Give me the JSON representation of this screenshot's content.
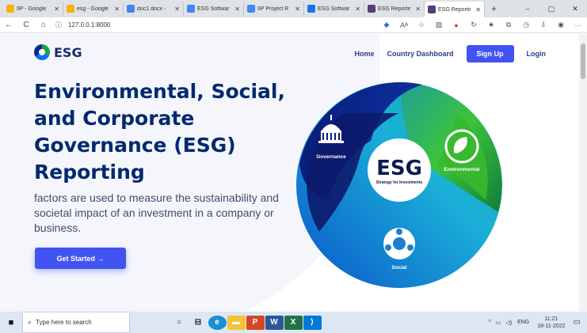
{
  "browser": {
    "tabs": [
      {
        "label": "IIP - Google",
        "icon": "google-drive-icon",
        "color": "#f4b400",
        "active": false
      },
      {
        "label": "esg - Google",
        "icon": "google-drive-icon",
        "color": "#f4b400",
        "active": false
      },
      {
        "label": "doc1.docx -",
        "icon": "google-docs-icon",
        "color": "#4285f4",
        "active": false
      },
      {
        "label": "ESG Softwar",
        "icon": "google-docs-icon",
        "color": "#4285f4",
        "active": false
      },
      {
        "label": "IIP Project R",
        "icon": "google-docs-icon",
        "color": "#4285f4",
        "active": false
      },
      {
        "label": "ESG Softwar",
        "icon": "globe-icon",
        "color": "#1a73e8",
        "active": false
      },
      {
        "label": "ESG Reportir",
        "icon": "bootstrap-icon",
        "color": "#563d7c",
        "active": false
      },
      {
        "label": "ESG Reportir",
        "icon": "bootstrap-icon",
        "color": "#563d7c",
        "active": true
      }
    ],
    "url": "127.0.0.1:8000"
  },
  "site": {
    "logo_text": "ESG",
    "nav": {
      "home": "Home",
      "country_dashboard": "Country Dashboard",
      "signup": "Sign Up",
      "login": "Login"
    },
    "hero_title": "Environmental, Social, and Corporate Governance (ESG) Reporting",
    "hero_desc": "factors are used to measure the sustainability and societal impact of an investment in a company or business.",
    "cta": "Get Started →",
    "graphic": {
      "center_title": "ESG",
      "center_sub": "Strategy for Investments",
      "governance": "Governance",
      "environmental": "Environmental",
      "social": "Social"
    }
  },
  "taskbar": {
    "search_placeholder": "Type here to search",
    "lang": "ENG",
    "time": "11:21",
    "date": "18-11-2022"
  }
}
